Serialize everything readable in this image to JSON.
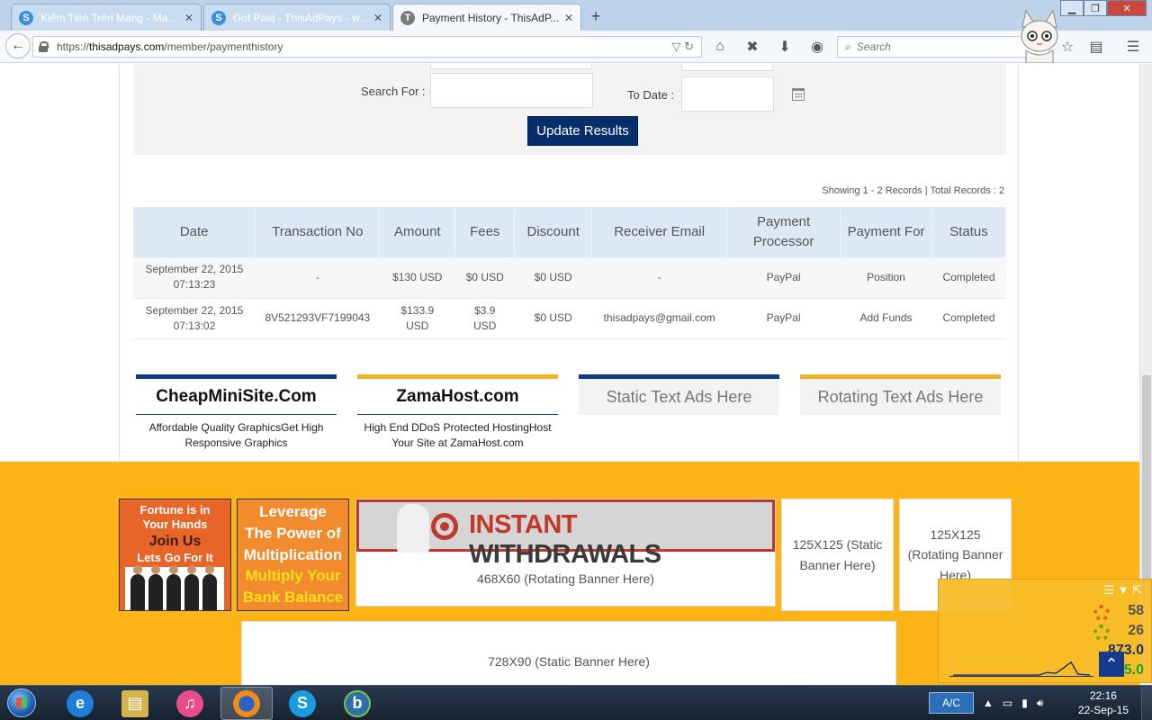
{
  "browser": {
    "tabs": [
      {
        "title": "Kiếm Tiền Trên Mạng - Ma...",
        "favicon": "S",
        "active": false
      },
      {
        "title": "Got Paid - ThisAdPays - w...",
        "favicon": "S",
        "active": false
      },
      {
        "title": "Payment History - ThisAdP...",
        "favicon": "T",
        "active": true
      }
    ],
    "url_prefix": "https://",
    "url_host": "thisadpays.com",
    "url_path": "/member/paymenthistory",
    "search_placeholder": "Search"
  },
  "filters": {
    "search_label": "Search For :",
    "to_date_label": "To Date :",
    "update_button": "Update Results"
  },
  "records_summary": "Showing 1 - 2 Records | Total Records : 2",
  "table": {
    "headers": [
      "Date",
      "Transaction No",
      "Amount",
      "Fees",
      "Discount",
      "Receiver Email",
      "Payment Processor",
      "Payment For",
      "Status"
    ],
    "rows": [
      {
        "date": "September 22, 2015",
        "time": "07:13:23",
        "txn": "-",
        "amount": "$130 USD",
        "fees": "$0 USD",
        "discount": "$0 USD",
        "email": "-",
        "processor": "PayPal",
        "payment_for": "Position",
        "status": "Completed"
      },
      {
        "date": "September 22, 2015",
        "time": "07:13:02",
        "txn": "8V521293VF7199043",
        "amount": "$133.9 USD",
        "fees": "$3.9 USD",
        "discount": "$0 USD",
        "email": "thisadpays@gmail.com",
        "processor": "PayPal",
        "payment_for": "Add Funds",
        "status": "Completed"
      }
    ]
  },
  "text_ads": [
    {
      "title": "CheapMiniSite.Com",
      "desc": "Affordable Quality GraphicsGet High Responsive Graphics",
      "bar_color": "#0b3b82"
    },
    {
      "title": "ZamaHost.com",
      "desc": "High End DDoS Protected HostingHost Your Site at ZamaHost.com",
      "bar_color": "#f0b323"
    },
    {
      "title": "Static Text Ads Here",
      "bar_color": "#0b3b82"
    },
    {
      "title": "Rotating Text Ads Here",
      "bar_color": "#f0b323"
    }
  ],
  "banners": {
    "b1_line1": "Fortune is in",
    "b1_line2": "Your Hands",
    "b1_line3": "Join Us",
    "b1_line4": "Lets Go For It",
    "b2_line1": "Leverage",
    "b2_line2": "The Power of",
    "b2_line3": "Multiplication",
    "b2_line4": "Multiply Your",
    "b2_line5": "Bank Balance",
    "b468_word1": "INSTANT",
    "b468_word2": "WITHDRAWALS",
    "b468_caption": "468X60 (Rotating Banner Here)",
    "static125": "125X125 (Static Banner Here)",
    "rotating125": "125X125 (Rotating Banner Here)",
    "static728": "728X90 (Static Banner Here)"
  },
  "widget": {
    "values": [
      "58",
      "26",
      "873.0",
      "205.0"
    ]
  },
  "taskbar": {
    "ac_label": "A/C",
    "time": "22:16",
    "date": "22-Sep-15"
  },
  "colors": {
    "accent_navy": "#062e6b",
    "table_header": "#dce8f4",
    "footer_orange": "#fcb416"
  }
}
